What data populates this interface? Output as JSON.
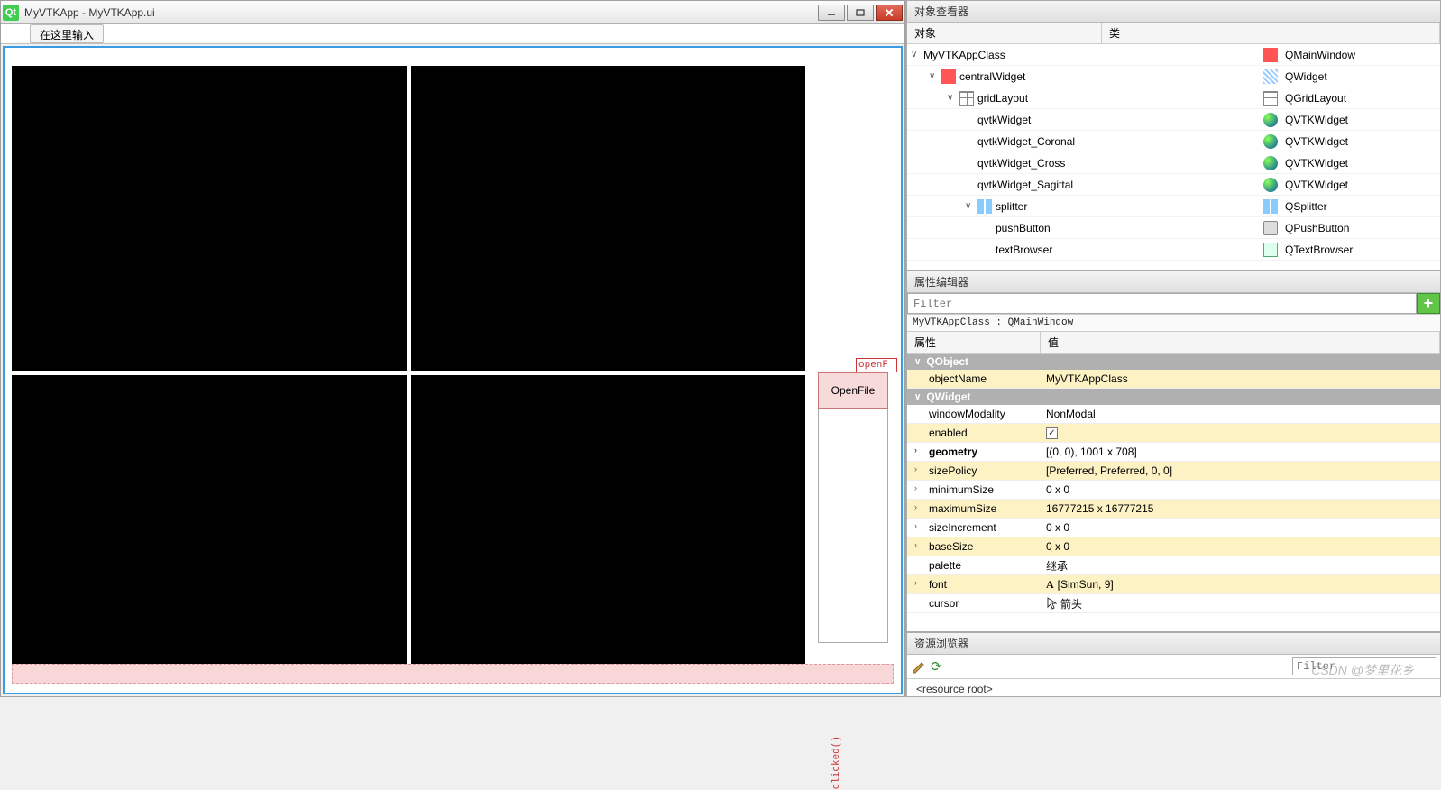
{
  "titlebar": {
    "title": "MyVTKApp - MyVTKApp.ui"
  },
  "toolbar": {
    "input_hint": "在这里输入"
  },
  "design": {
    "open_button": "OpenFile",
    "signal_slot": "openF",
    "signal_clicked": "clicked()"
  },
  "object_inspector": {
    "title": "对象查看器",
    "headers": {
      "object": "对象",
      "class": "类"
    },
    "tree": [
      {
        "indent": 0,
        "expander": "∨",
        "name": "MyVTKAppClass",
        "class": "QMainWindow",
        "icon": "ic-window"
      },
      {
        "indent": 1,
        "expander": "∨",
        "name": "centralWidget",
        "class": "QWidget",
        "icon": "ic-widget",
        "pre_icon": "ic-window"
      },
      {
        "indent": 2,
        "expander": "∨",
        "name": "gridLayout",
        "class": "QGridLayout",
        "icon": "ic-grid",
        "pre_icon": "ic-grid"
      },
      {
        "indent": 3,
        "expander": "",
        "name": "qvtkWidget",
        "class": "QVTKWidget",
        "icon": "ic-vtk"
      },
      {
        "indent": 3,
        "expander": "",
        "name": "qvtkWidget_Coronal",
        "class": "QVTKWidget",
        "icon": "ic-vtk"
      },
      {
        "indent": 3,
        "expander": "",
        "name": "qvtkWidget_Cross",
        "class": "QVTKWidget",
        "icon": "ic-vtk"
      },
      {
        "indent": 3,
        "expander": "",
        "name": "qvtkWidget_Sagittal",
        "class": "QVTKWidget",
        "icon": "ic-vtk"
      },
      {
        "indent": 3,
        "expander": "∨",
        "name": "splitter",
        "class": "QSplitter",
        "icon": "ic-split",
        "pre_icon": "ic-split"
      },
      {
        "indent": 4,
        "expander": "",
        "name": "pushButton",
        "class": "QPushButton",
        "icon": "ic-pushbtn"
      },
      {
        "indent": 4,
        "expander": "",
        "name": "textBrowser",
        "class": "QTextBrowser",
        "icon": "ic-textbr"
      }
    ]
  },
  "property_editor": {
    "title": "属性编辑器",
    "filter_placeholder": "Filter",
    "breadcrumb": "MyVTKAppClass : QMainWindow",
    "headers": {
      "property": "属性",
      "value": "值"
    },
    "groups": [
      {
        "name": "QObject",
        "rows": [
          {
            "hl": true,
            "name": "objectName",
            "value": "MyVTKAppClass"
          }
        ]
      },
      {
        "name": "QWidget",
        "rows": [
          {
            "hl": false,
            "name": "windowModality",
            "value": "NonModal"
          },
          {
            "hl": true,
            "name": "enabled",
            "value_type": "check",
            "checked": true
          },
          {
            "hl": false,
            "name": "geometry",
            "bold": true,
            "exp": "›",
            "value": "[(0, 0), 1001 x 708]"
          },
          {
            "hl": true,
            "name": "sizePolicy",
            "exp": "›",
            "value": "[Preferred, Preferred, 0, 0]"
          },
          {
            "hl": false,
            "name": "minimumSize",
            "exp": "›",
            "value": "0 x 0"
          },
          {
            "hl": true,
            "name": "maximumSize",
            "exp": "›",
            "value": "16777215 x 16777215"
          },
          {
            "hl": false,
            "name": "sizeIncrement",
            "exp": "›",
            "value": "0 x 0"
          },
          {
            "hl": true,
            "name": "baseSize",
            "exp": "›",
            "value": "0 x 0"
          },
          {
            "hl": false,
            "name": "palette",
            "value": "继承"
          },
          {
            "hl": true,
            "name": "font",
            "exp": "›",
            "value": "[SimSun, 9]",
            "value_icon": "font-A"
          },
          {
            "hl": false,
            "name": "cursor",
            "value": "箭头",
            "value_icon": "cursor-ic"
          }
        ]
      }
    ]
  },
  "resource_browser": {
    "title": "资源浏览器",
    "filter_placeholder": "Filter",
    "root_label": "<resource root>"
  },
  "watermark": "CSDN @梦里花乡"
}
